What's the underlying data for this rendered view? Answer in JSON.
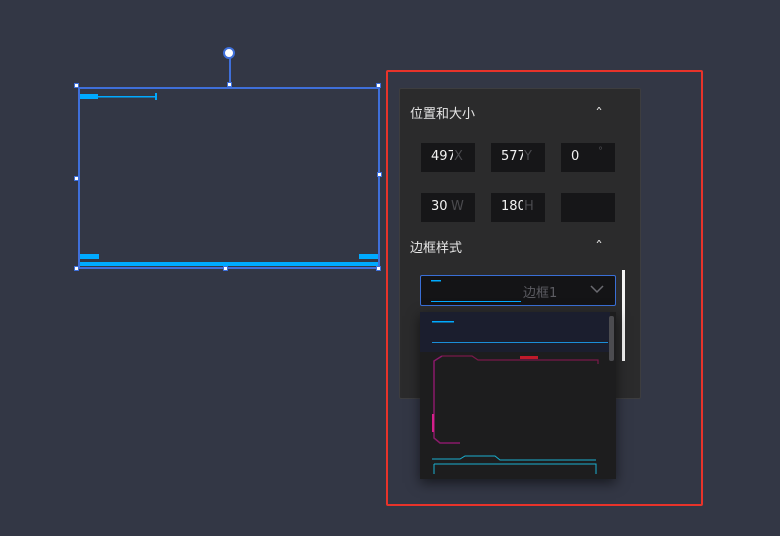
{
  "canvas": {
    "accent_color": "#00aaff",
    "selection_color": "#3f6fd9"
  },
  "panel": {
    "position_size_title": "位置和大小",
    "collapse_icon": "chevron-up-icon",
    "fields": {
      "x": {
        "value": "497",
        "unit": "X"
      },
      "y": {
        "value": "577",
        "unit": "Y"
      },
      "rotation": {
        "value": "0",
        "unit": "°"
      },
      "width": {
        "value": "30",
        "unit": "W"
      },
      "height": {
        "value": "180",
        "unit": "H"
      },
      "extra": {
        "value": "",
        "unit": ""
      }
    },
    "border_style_title": "边框样式",
    "border_select": {
      "value": "边框1",
      "icon": "chevron-down-icon"
    }
  },
  "highlight_color": "#e8332a"
}
